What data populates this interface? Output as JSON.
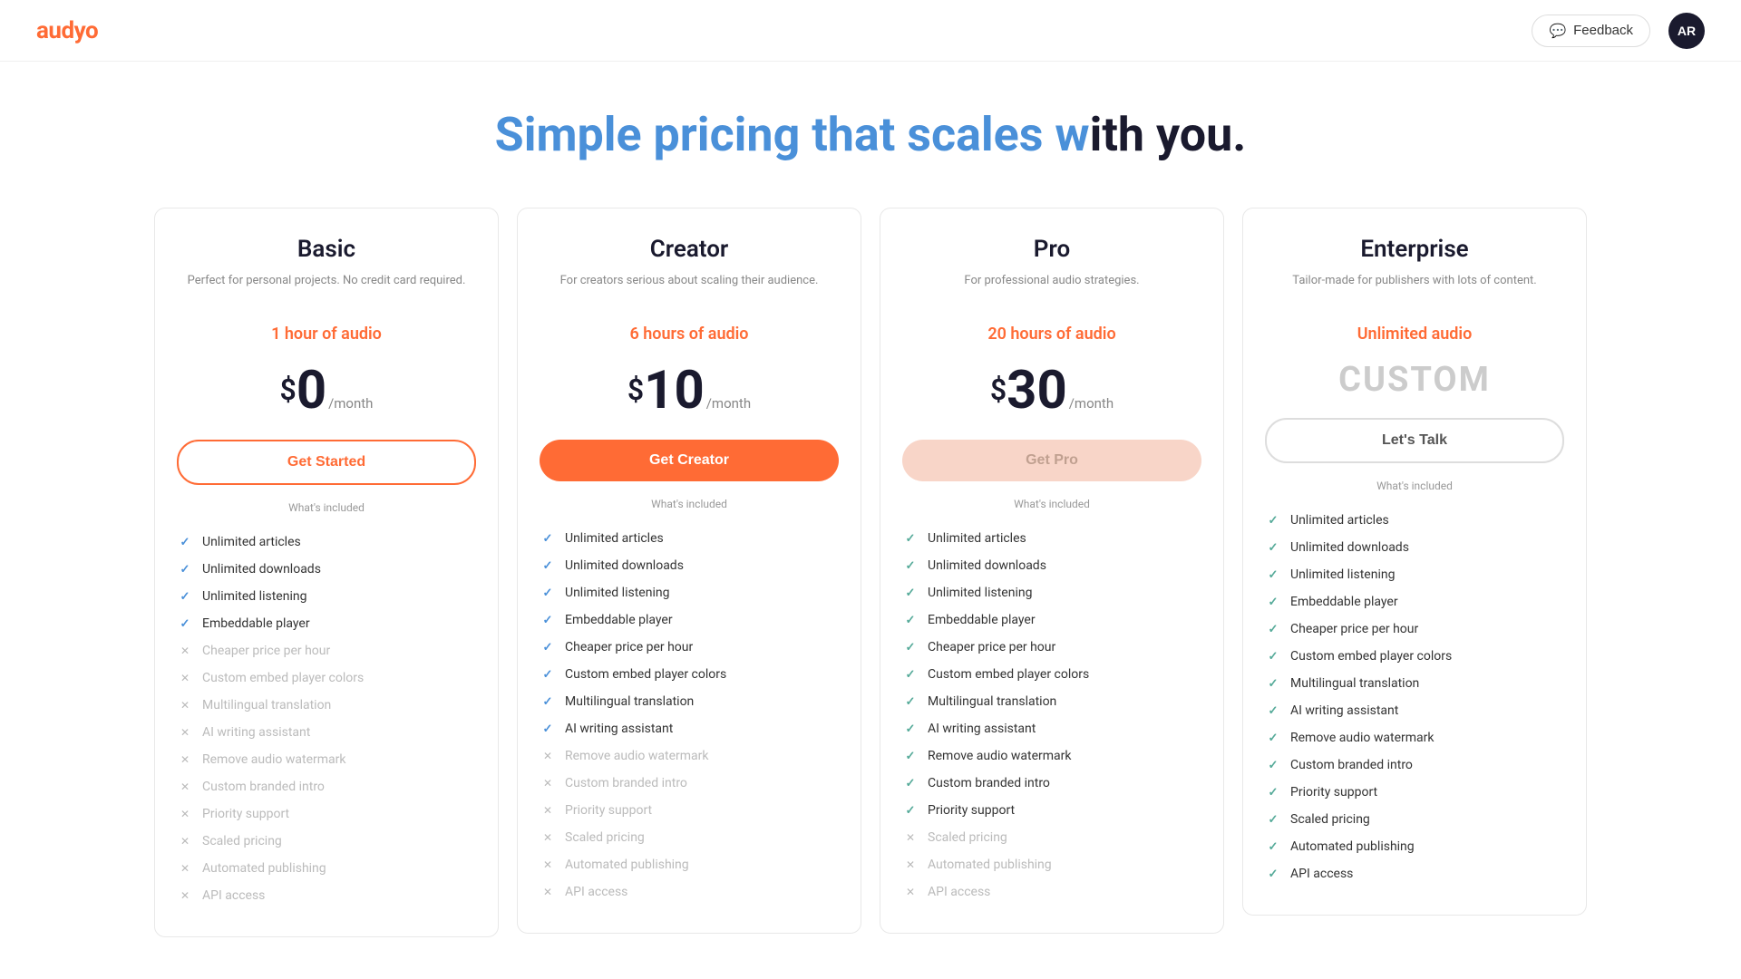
{
  "header": {
    "logo": "audyo",
    "feedback_label": "Feedback",
    "avatar_label": "AR"
  },
  "hero": {
    "title_plain": "Simple pricing that scales w",
    "title_highlight": "Simple pricing that scales w",
    "title_full": "Simple pricing that scales with you.",
    "title_part1": "Simple pricing that scales w",
    "title_part2": "ith you."
  },
  "plans": [
    {
      "id": "basic",
      "name": "Basic",
      "desc": "Perfect for personal projects. No credit card required.",
      "audio": "1 hour of audio",
      "price": "0",
      "currency": "$",
      "period": "/month",
      "btn_label": "Get Started",
      "btn_class": "btn-basic",
      "features": [
        {
          "label": "Unlimited articles",
          "included": true
        },
        {
          "label": "Unlimited downloads",
          "included": true
        },
        {
          "label": "Unlimited listening",
          "included": true
        },
        {
          "label": "Embeddable player",
          "included": true
        },
        {
          "label": "Cheaper price per hour",
          "included": false
        },
        {
          "label": "Custom embed player colors",
          "included": false
        },
        {
          "label": "Multilingual translation",
          "included": false
        },
        {
          "label": "AI writing assistant",
          "included": false
        },
        {
          "label": "Remove audio watermark",
          "included": false
        },
        {
          "label": "Custom branded intro",
          "included": false
        },
        {
          "label": "Priority support",
          "included": false
        },
        {
          "label": "Scaled pricing",
          "included": false
        },
        {
          "label": "Automated publishing",
          "included": false
        },
        {
          "label": "API access",
          "included": false
        }
      ]
    },
    {
      "id": "creator",
      "name": "Creator",
      "desc": "For creators serious about scaling their audience.",
      "audio": "6 hours of audio",
      "price": "10",
      "currency": "$",
      "period": "/month",
      "btn_label": "Get Creator",
      "btn_class": "btn-creator",
      "features": [
        {
          "label": "Unlimited articles",
          "included": true
        },
        {
          "label": "Unlimited downloads",
          "included": true
        },
        {
          "label": "Unlimited listening",
          "included": true
        },
        {
          "label": "Embeddable player",
          "included": true
        },
        {
          "label": "Cheaper price per hour",
          "included": true
        },
        {
          "label": "Custom embed player colors",
          "included": true
        },
        {
          "label": "Multilingual translation",
          "included": true
        },
        {
          "label": "AI writing assistant",
          "included": true
        },
        {
          "label": "Remove audio watermark",
          "included": false
        },
        {
          "label": "Custom branded intro",
          "included": false
        },
        {
          "label": "Priority support",
          "included": false
        },
        {
          "label": "Scaled pricing",
          "included": false
        },
        {
          "label": "Automated publishing",
          "included": false
        },
        {
          "label": "API access",
          "included": false
        }
      ]
    },
    {
      "id": "pro",
      "name": "Pro",
      "desc": "For professional audio strategies.",
      "audio": "20 hours of audio",
      "price": "30",
      "currency": "$",
      "period": "/month",
      "btn_label": "Get Pro",
      "btn_class": "btn-pro",
      "features": [
        {
          "label": "Unlimited articles",
          "included": true
        },
        {
          "label": "Unlimited downloads",
          "included": true
        },
        {
          "label": "Unlimited listening",
          "included": true
        },
        {
          "label": "Embeddable player",
          "included": true
        },
        {
          "label": "Cheaper price per hour",
          "included": true
        },
        {
          "label": "Custom embed player colors",
          "included": true
        },
        {
          "label": "Multilingual translation",
          "included": true
        },
        {
          "label": "AI writing assistant",
          "included": true
        },
        {
          "label": "Remove audio watermark",
          "included": true
        },
        {
          "label": "Custom branded intro",
          "included": true
        },
        {
          "label": "Priority support",
          "included": true
        },
        {
          "label": "Scaled pricing",
          "included": false
        },
        {
          "label": "Automated publishing",
          "included": false
        },
        {
          "label": "API access",
          "included": false
        }
      ]
    },
    {
      "id": "enterprise",
      "name": "Enterprise",
      "desc": "Tailor-made for publishers with lots of content.",
      "audio": "Unlimited audio",
      "price": "CUSTOM",
      "is_custom": true,
      "btn_label": "Let's Talk",
      "btn_class": "btn-enterprise",
      "features": [
        {
          "label": "Unlimited articles",
          "included": true
        },
        {
          "label": "Unlimited downloads",
          "included": true
        },
        {
          "label": "Unlimited listening",
          "included": true
        },
        {
          "label": "Embeddable player",
          "included": true
        },
        {
          "label": "Cheaper price per hour",
          "included": true
        },
        {
          "label": "Custom embed player colors",
          "included": true
        },
        {
          "label": "Multilingual translation",
          "included": true
        },
        {
          "label": "AI writing assistant",
          "included": true
        },
        {
          "label": "Remove audio watermark",
          "included": true
        },
        {
          "label": "Custom branded intro",
          "included": true
        },
        {
          "label": "Priority support",
          "included": true
        },
        {
          "label": "Scaled pricing",
          "included": true
        },
        {
          "label": "Automated publishing",
          "included": true
        },
        {
          "label": "API access",
          "included": true
        }
      ]
    }
  ],
  "whats_included_label": "What's included",
  "speech_bubble_icon": "💬"
}
